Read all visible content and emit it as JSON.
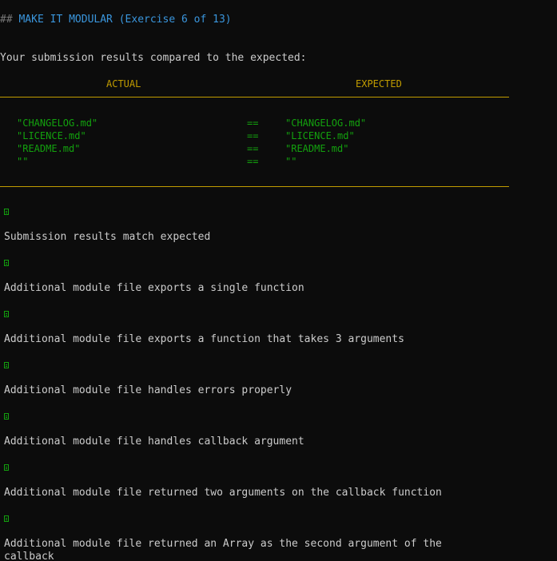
{
  "title": {
    "prefix": "##",
    "text": "MAKE IT MODULAR (Exercise 6 of 13)"
  },
  "intro": "Your submission results compared to the expected:",
  "table": {
    "actual_header": "ACTUAL",
    "expected_header": "EXPECTED",
    "rows": [
      {
        "actual": "\"CHANGELOG.md\"",
        "op": "==",
        "expected": "\"CHANGELOG.md\""
      },
      {
        "actual": "\"LICENCE.md\"",
        "op": "==",
        "expected": "\"LICENCE.md\""
      },
      {
        "actual": "\"README.md\"",
        "op": "==",
        "expected": "\"README.md\""
      },
      {
        "actual": "\"\"",
        "op": "==",
        "expected": "\"\""
      }
    ]
  },
  "results": [
    {
      "icon": "check-box-icon",
      "message": "Submission results match expected"
    },
    {
      "icon": "check-box-icon",
      "message": "Additional module file exports a single function"
    },
    {
      "icon": "check-box-icon",
      "message": "Additional module file exports a function that takes 3 arguments"
    },
    {
      "icon": "check-box-icon",
      "message": "Additional module file handles errors properly"
    },
    {
      "icon": "check-box-icon",
      "message": "Additional module file handles callback argument"
    },
    {
      "icon": "check-box-icon",
      "message": "Additional module file returned two arguments on the callback function"
    },
    {
      "icon": "check-box-icon",
      "message": "Additional module file returned an Array as the second argument of the\ncallback"
    }
  ],
  "colors": {
    "background": "#0c0c0c",
    "title": "#3a96dd",
    "rule_and_headers": "#c19c00",
    "match": "#13a10e",
    "text": "#cccccc"
  }
}
